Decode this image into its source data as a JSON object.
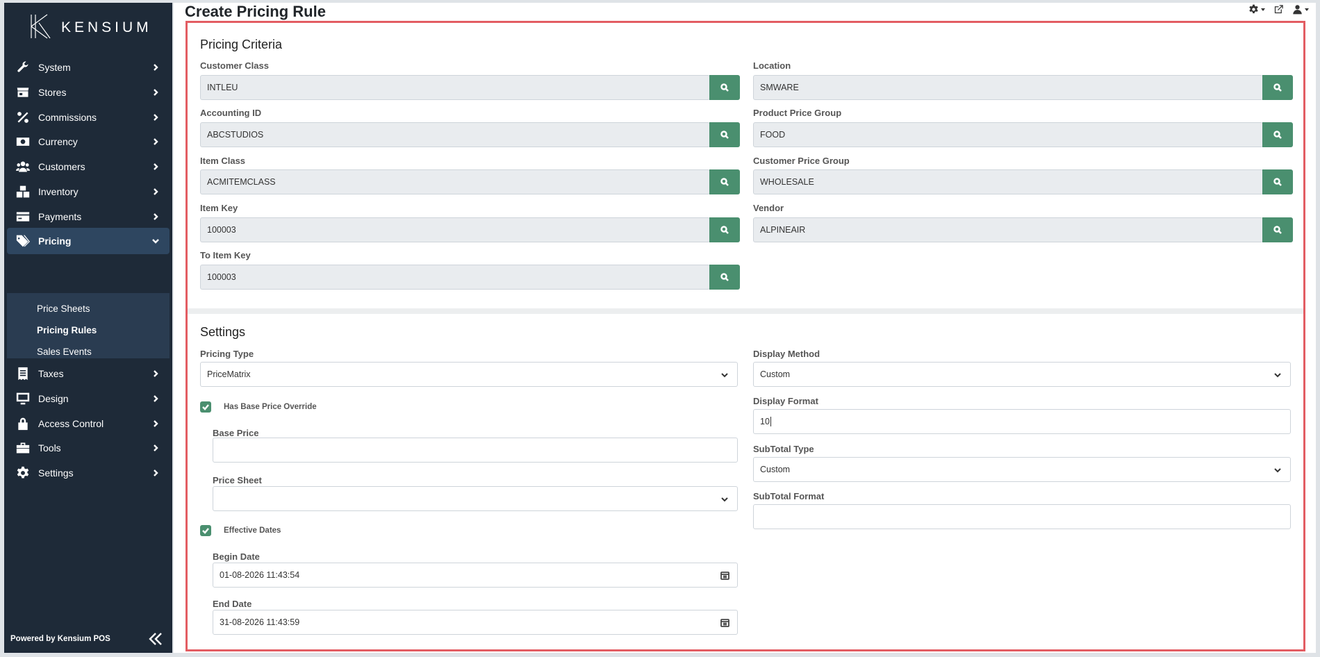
{
  "app": {
    "logo_text": "KENSIUM",
    "powered_by": "Powered by Kensium POS"
  },
  "sidebar": {
    "items": [
      {
        "label": "System",
        "icon": "wrench-icon"
      },
      {
        "label": "Stores",
        "icon": "store-icon"
      },
      {
        "label": "Commissions",
        "icon": "percent-icon"
      },
      {
        "label": "Currency",
        "icon": "money-bill-icon"
      },
      {
        "label": "Customers",
        "icon": "users-icon"
      },
      {
        "label": "Inventory",
        "icon": "boxes-icon"
      },
      {
        "label": "Payments",
        "icon": "credit-card-icon"
      },
      {
        "label": "Pricing",
        "icon": "tags-icon"
      },
      {
        "label": "Taxes",
        "icon": "receipt-icon"
      },
      {
        "label": "Design",
        "icon": "desktop-icon"
      },
      {
        "label": "Access Control",
        "icon": "lock-icon"
      },
      {
        "label": "Tools",
        "icon": "toolbox-icon"
      },
      {
        "label": "Settings",
        "icon": "gear-icon"
      }
    ],
    "active": "Pricing",
    "sub_items": [
      {
        "label": "Price Sheets"
      },
      {
        "label": "Pricing Rules"
      },
      {
        "label": "Sales Events"
      }
    ],
    "active_sub": "Pricing Rules"
  },
  "header": {
    "title": "Create Pricing Rule"
  },
  "criteria": {
    "title": "Pricing Criteria",
    "fields": [
      {
        "label": "Customer Class",
        "value": "INTLEU"
      },
      {
        "label": "Location",
        "value": "SMWARE"
      },
      {
        "label": "Accounting ID",
        "value": "ABCSTUDIOS"
      },
      {
        "label": "Product Price Group",
        "value": "FOOD"
      },
      {
        "label": "Item Class",
        "value": "ACMITEMCLASS"
      },
      {
        "label": "Customer Price Group",
        "value": "WHOLESALE"
      },
      {
        "label": "Item Key",
        "value": "100003"
      },
      {
        "label": "Vendor",
        "value": "ALPINEAIR"
      },
      {
        "label": "To Item Key",
        "value": "100003"
      }
    ]
  },
  "settings": {
    "title": "Settings",
    "pricing_type": {
      "label": "Pricing Type",
      "value": "PriceMatrix"
    },
    "has_base_price_override": {
      "label": "Has Base Price Override",
      "checked": true
    },
    "base_price": {
      "label": "Base Price",
      "value": ""
    },
    "price_sheet": {
      "label": "Price Sheet",
      "value": ""
    },
    "effective_dates": {
      "label": "Effective Dates",
      "checked": true
    },
    "begin_date": {
      "label": "Begin Date",
      "value": "01-08-2026 11:43:54"
    },
    "end_date": {
      "label": "End Date",
      "value": "31-08-2026 11:43:59"
    },
    "display_method": {
      "label": "Display Method",
      "value": "Custom"
    },
    "display_format": {
      "label": "Display Format",
      "value": "10"
    },
    "subtotal_type": {
      "label": "SubTotal Type",
      "value": "Custom"
    },
    "subtotal_format": {
      "label": "SubTotal Format",
      "value": ""
    }
  },
  "colors": {
    "sidebar_bg": "#1e2a38",
    "accent_green": "#4a8f6f",
    "highlight_red": "#e35d63"
  }
}
